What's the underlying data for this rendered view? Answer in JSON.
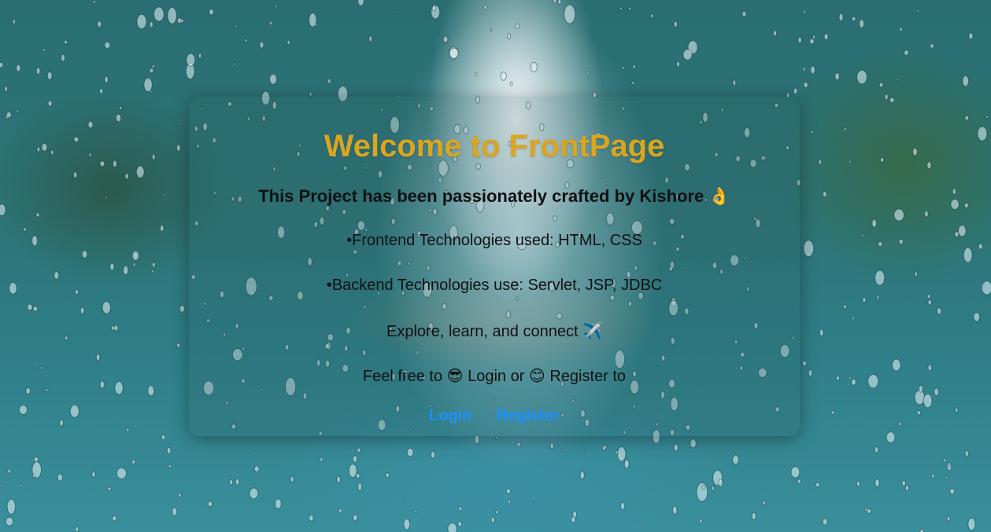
{
  "card": {
    "title": "Welcome to FrontPage",
    "subtitle": "This Project has been passionately crafted by Kishore",
    "subtitle_emoji": "👌",
    "frontend_line": "•Frontend Technologies used: HTML, CSS",
    "backend_line": "•Backend Technologies use: Servlet, JSP, JDBC",
    "explore_text": "Explore, learn, and connect",
    "explore_emoji": "✈️",
    "invite_prefix": "Feel free to",
    "invite_emoji_1": "😎",
    "invite_middle": "Login or",
    "invite_emoji_2": "😊",
    "invite_suffix": "Register to"
  },
  "links": {
    "login_label": "Login",
    "register_label": "Register"
  },
  "colors": {
    "title": "#daa520",
    "link": "#1e90ff",
    "text": "#111111"
  }
}
